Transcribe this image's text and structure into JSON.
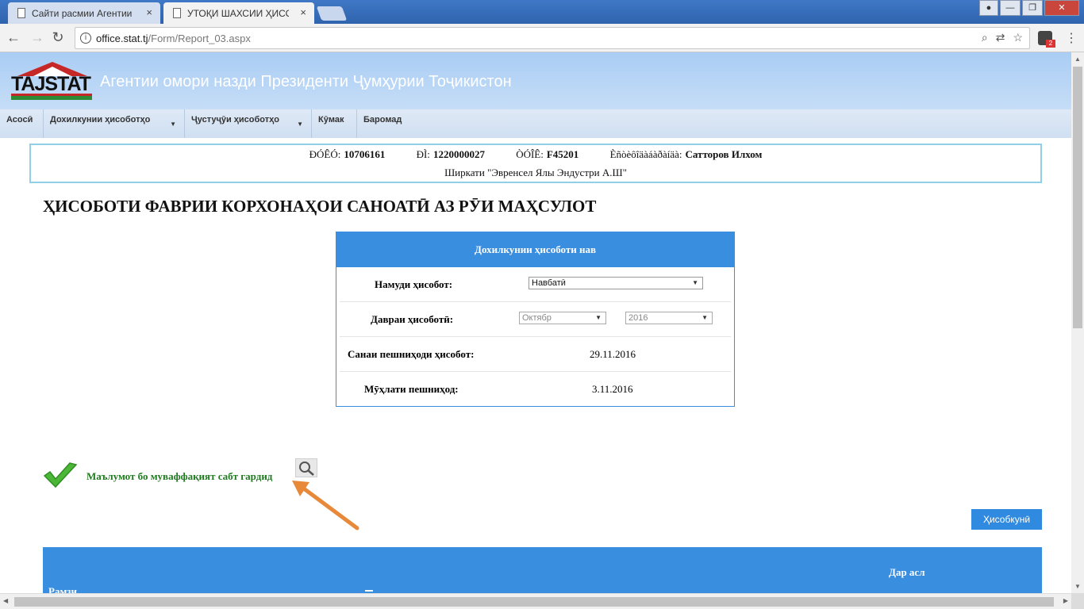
{
  "browser": {
    "tabs": [
      {
        "title": "Сайти расмии Агентии",
        "active": false
      },
      {
        "title": "УТОҚИ ШАХСИИ ҲИСОБ",
        "active": true
      }
    ],
    "tab_close_glyph": "×",
    "address": {
      "host": "office.stat.tj",
      "path": "/Form/Report_03.aspx"
    },
    "ext_badge": "2"
  },
  "site": {
    "logo_text": "TAJSTAT",
    "title": "Агентии омори назди Президенти Ҷумҳурии Тоҷикистон",
    "nav": [
      {
        "label": "Асосӣ"
      },
      {
        "label": "Дохилкунии ҳисоботҳо"
      },
      {
        "label": "Ҷустуҷӯи ҳисоботҳо"
      },
      {
        "label": "Кӯмак"
      },
      {
        "label": "Баромад"
      }
    ]
  },
  "info": {
    "fields": [
      {
        "label": "ÐÓÊÓ:",
        "value": "10706161"
      },
      {
        "label": "ÐÌ:",
        "value": "1220000027"
      },
      {
        "label": "ÒÓÎÊ:",
        "value": "F45201"
      },
      {
        "label": "Èñòèôîäàáàðàíäà:",
        "value": "Сатторов Илхом"
      }
    ],
    "company": "Ширкати \"Эвренсел Ялы Эндустри А.Ш\""
  },
  "heading": "ҲИСОБОТИ ФАВРИИ КОРХОНАҲОИ САНОАТӢ АЗ РӮИ МАҲСУЛОТ",
  "form": {
    "title": "Дохилкунии ҳисоботи нав",
    "report_type_label": "Намуди ҳисобот:",
    "report_type_value": "Навбатӣ",
    "period_label": "Давраи ҳисоботӣ:",
    "period_month": "Октябр",
    "period_year": "2016",
    "submit_date_label": "Санаи пешниҳоди ҳисобот:",
    "submit_date_value": "29.11.2016",
    "deadline_label": "Мӯҳлати пешниҳод:",
    "deadline_value": "3.11.2016"
  },
  "status": {
    "message": "Маълумот бо муваффақият сабт гардид"
  },
  "actions": {
    "calculate": "Ҳисобкунӣ"
  },
  "table": {
    "col_code": "Рамзи",
    "col_actual": "Дар асл"
  },
  "colors": {
    "accent": "#3a8ee0",
    "success": "#1f7a1f",
    "annotation": "#e8893a"
  }
}
